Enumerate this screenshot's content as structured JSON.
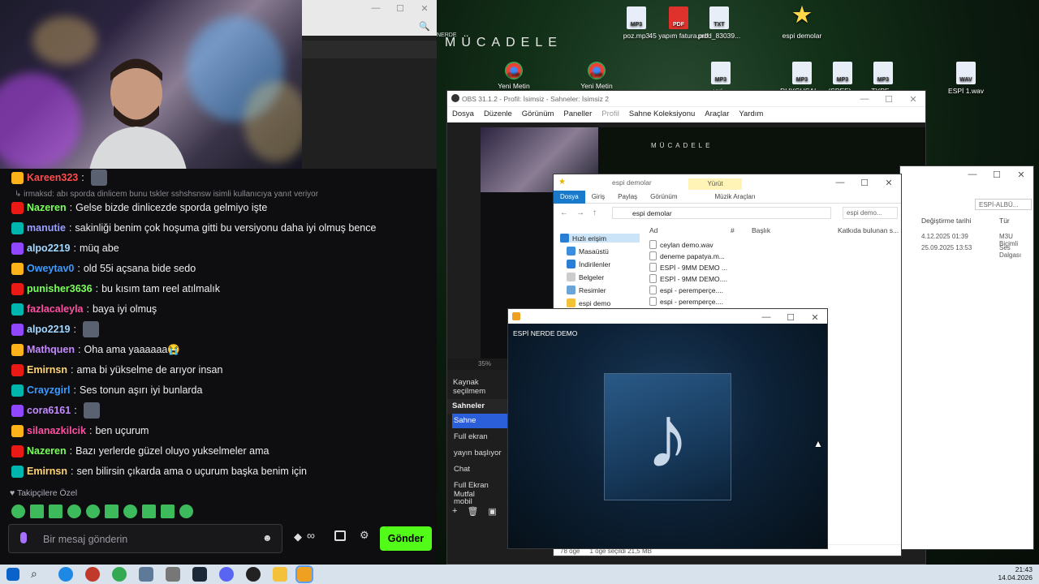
{
  "stream_window": {
    "close_glyph": "✕",
    "restore_glyph": "☐",
    "minimize_glyph": "—",
    "zoom_glyph": "🔍"
  },
  "chat": {
    "reply_notice": "↳ irmaksd: abı sporda dinlicem bunu tskler sshshsnsw isimli kullanıcıya yanıt veriyor",
    "messages": [
      {
        "user": "Kareen323",
        "color": "#ff4d4d",
        "text": "",
        "emote": true
      },
      {
        "user": "Nazeren",
        "color": "#7bff5c",
        "text": "Gelse bizde dinlicezde sporda gelmiyo işte"
      },
      {
        "user": "manutie",
        "color": "#9aa0ff",
        "text": "sakinliği benim çok hoşuma gitti bu versiyonu daha iyi olmuş bence"
      },
      {
        "user": "alpo2219",
        "color": "#a2d8ff",
        "text": "müq abe"
      },
      {
        "user": "Oweytav0",
        "color": "#3d9bff",
        "text": "old 55i açsana bide sedo"
      },
      {
        "user": "punisher3636",
        "color": "#7bff5c",
        "text": "bu kısım tam reel atılmalık"
      },
      {
        "user": "fazlacaleyla",
        "color": "#ff4fa3",
        "text": "baya iyi olmuş"
      },
      {
        "user": "alpo2219",
        "color": "#a2d8ff",
        "text": "",
        "emote": true
      },
      {
        "user": "Mathquen",
        "color": "#c48aff",
        "text": "Oha ama yaaaaaa😭"
      },
      {
        "user": "Emirnsn",
        "color": "#ffd479",
        "text": "ama bi yükselme de arıyor insan"
      },
      {
        "user": "Crayzgirl",
        "color": "#3d9bff",
        "text": "Ses tonun aşırı iyi bunlarda"
      },
      {
        "user": "cora6161",
        "color": "#c48aff",
        "text": "",
        "emote": true
      },
      {
        "user": "silanazkilcik",
        "color": "#ff4fa3",
        "text": "ben uçurum"
      },
      {
        "user": "Nazeren",
        "color": "#7bff5c",
        "text": "Bazı yerlerde güzel oluyo yukselmeler ama"
      },
      {
        "user": "Emirnsn",
        "color": "#ffd479",
        "text": "sen bilirsin çıkarda ama o uçurum başka benim için"
      }
    ],
    "followers_only": "Takipçilere Özel",
    "input_placeholder": "Bir mesaj gönderin",
    "send_label": "Gönder",
    "points_glyph": "∞"
  },
  "desktop": {
    "title_text": "MÜCADELE",
    "partial_label": "NERDE",
    "icons": [
      {
        "label": "poz.mp3",
        "type": "MP3"
      },
      {
        "label": "45 yapım fatura.pdf",
        "type": "PDF"
      },
      {
        "label": "prod_83039...",
        "type": "TXT"
      },
      {
        "label": "espi demolar",
        "type": "★"
      },
      {
        "label": "Yeni Metin",
        "type": "CHR"
      },
      {
        "label": "Yeni Metin",
        "type": "CHR"
      },
      {
        "label": "yui...",
        "type": "MP3"
      },
      {
        "label": "DUYGUSAL...",
        "type": "MP3"
      },
      {
        "label": "(SPEE)...",
        "type": "MP3"
      },
      {
        "label": "TYPE...",
        "type": "MP3"
      },
      {
        "label": "ESPİ 1.wav",
        "type": "WAV"
      }
    ]
  },
  "obs": {
    "title": "OBS 31.1.2 - Profil: İsimsiz - Sahneler: İsimsiz 2",
    "menu": [
      "Dosya",
      "Düzenle",
      "Görünüm",
      "Paneller",
      "Profil",
      "Sahne Koleksiyonu",
      "Araçlar",
      "Yardım"
    ],
    "zoom": "35%",
    "sources_label": "Kaynak seçilmem",
    "scenes_header": "Sahneler",
    "scenes": [
      "Sahne",
      "Full ekran",
      "yayın başlıyor",
      "Chat",
      "Full Ekran Mutfal",
      "mobil"
    ]
  },
  "explorer": {
    "title": "espi demolar",
    "run_tab": "Yürüt",
    "tabs": [
      "Dosya",
      "Giriş",
      "Paylaş",
      "Görünüm",
      "Müzik Araçları"
    ],
    "address": "espi demolar",
    "search_placeholder": "espi demo...",
    "columns": [
      "Ad",
      "#",
      "Başlık",
      "Katkıda bulunan s..."
    ],
    "nav": [
      "Hızlı erişim",
      "Masaüstü",
      "İndirilenler",
      "Belgeler",
      "Resimler",
      "espi demo"
    ],
    "files": [
      "ceylan demo.wav",
      "deneme papatya.m...",
      "ESPİ - 9MM DEMO ...",
      "ESPİ - 9MM DEMO....",
      "espi - peremperçe....",
      "espi - peremperçe...."
    ],
    "status_count": "78 öğe",
    "status_selected": "1 öğe seçildi 21,5 MB"
  },
  "explorer2": {
    "search_placeholder": "ESPİ-ALBÜ...",
    "columns": [
      "Değiştirme tarihi",
      "Tür"
    ],
    "rows": [
      {
        "date": "4.12.2025 01:39",
        "type": "M3U Biçimli"
      },
      {
        "date": "25.09.2025 13:53",
        "type": "Ses Dalgası"
      }
    ]
  },
  "player": {
    "title": "ESPİ NERDE DEMO",
    "art_glyph": "♪"
  },
  "taskbar": {
    "time": "21:43",
    "date": "14.04.2026"
  },
  "colors": {
    "twitch_green": "#53fc18",
    "obs_accent": "#2b5fd9"
  }
}
